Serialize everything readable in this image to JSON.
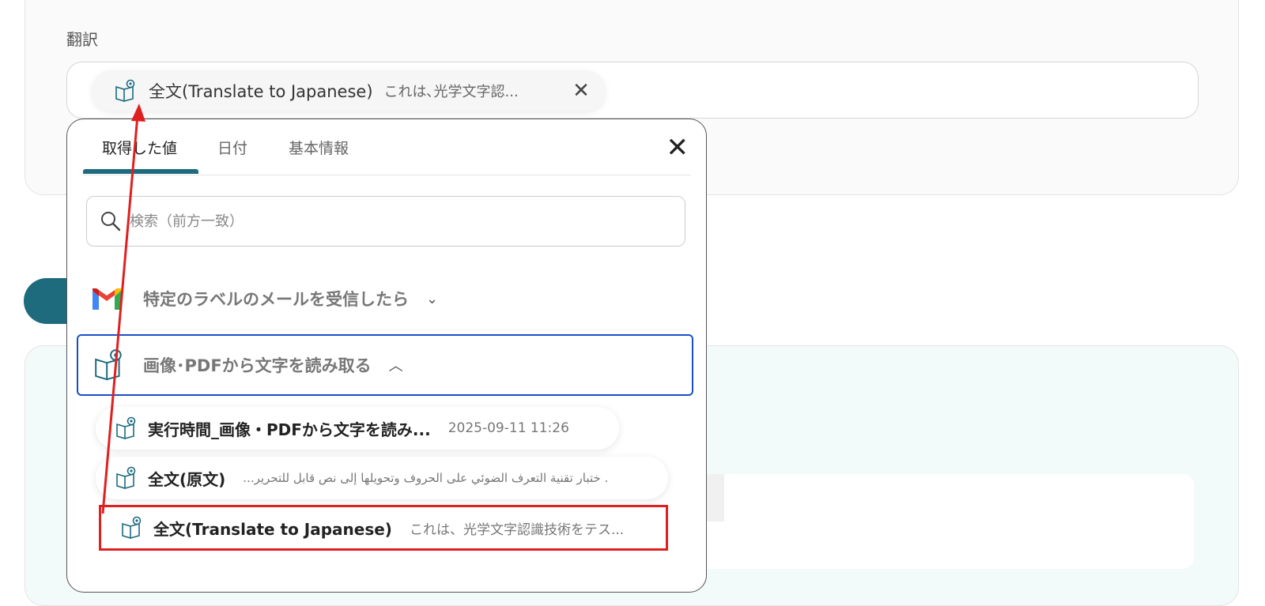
{
  "section": {
    "label": "翻訳"
  },
  "selected_chip": {
    "label": "全文(Translate to Japanese)",
    "preview": "これは､光学文字認...",
    "close_glyph": "✕"
  },
  "popup": {
    "tabs": [
      {
        "label": "取得した値"
      },
      {
        "label": "日付"
      },
      {
        "label": "基本情報"
      }
    ],
    "close_glyph": "✕",
    "search": {
      "placeholder": "検索（前方一致）",
      "value": ""
    },
    "groups": [
      {
        "label": "特定のラベルのメールを受信したら",
        "chevron": "⌄"
      },
      {
        "label": "画像･PDFから文字を読み取る",
        "chevron": "︿"
      }
    ],
    "items": [
      {
        "label": "実行時間_画像・PDFから文字を読み...",
        "value": "2025-09-11 11:26"
      },
      {
        "label": "全文(原文)",
        "value": "...ختبار تقنية التعرف الضوئي على الحروف وتحويلها إلى نص قابل للتحرير ."
      },
      {
        "label": "全文(Translate to Japanese)",
        "value": "これは、光学文字認識技術をテス..."
      }
    ]
  },
  "colors": {
    "accent": "#1e6b7e",
    "selection_border": "#1a4fc4",
    "annotation_red": "#e02020"
  }
}
